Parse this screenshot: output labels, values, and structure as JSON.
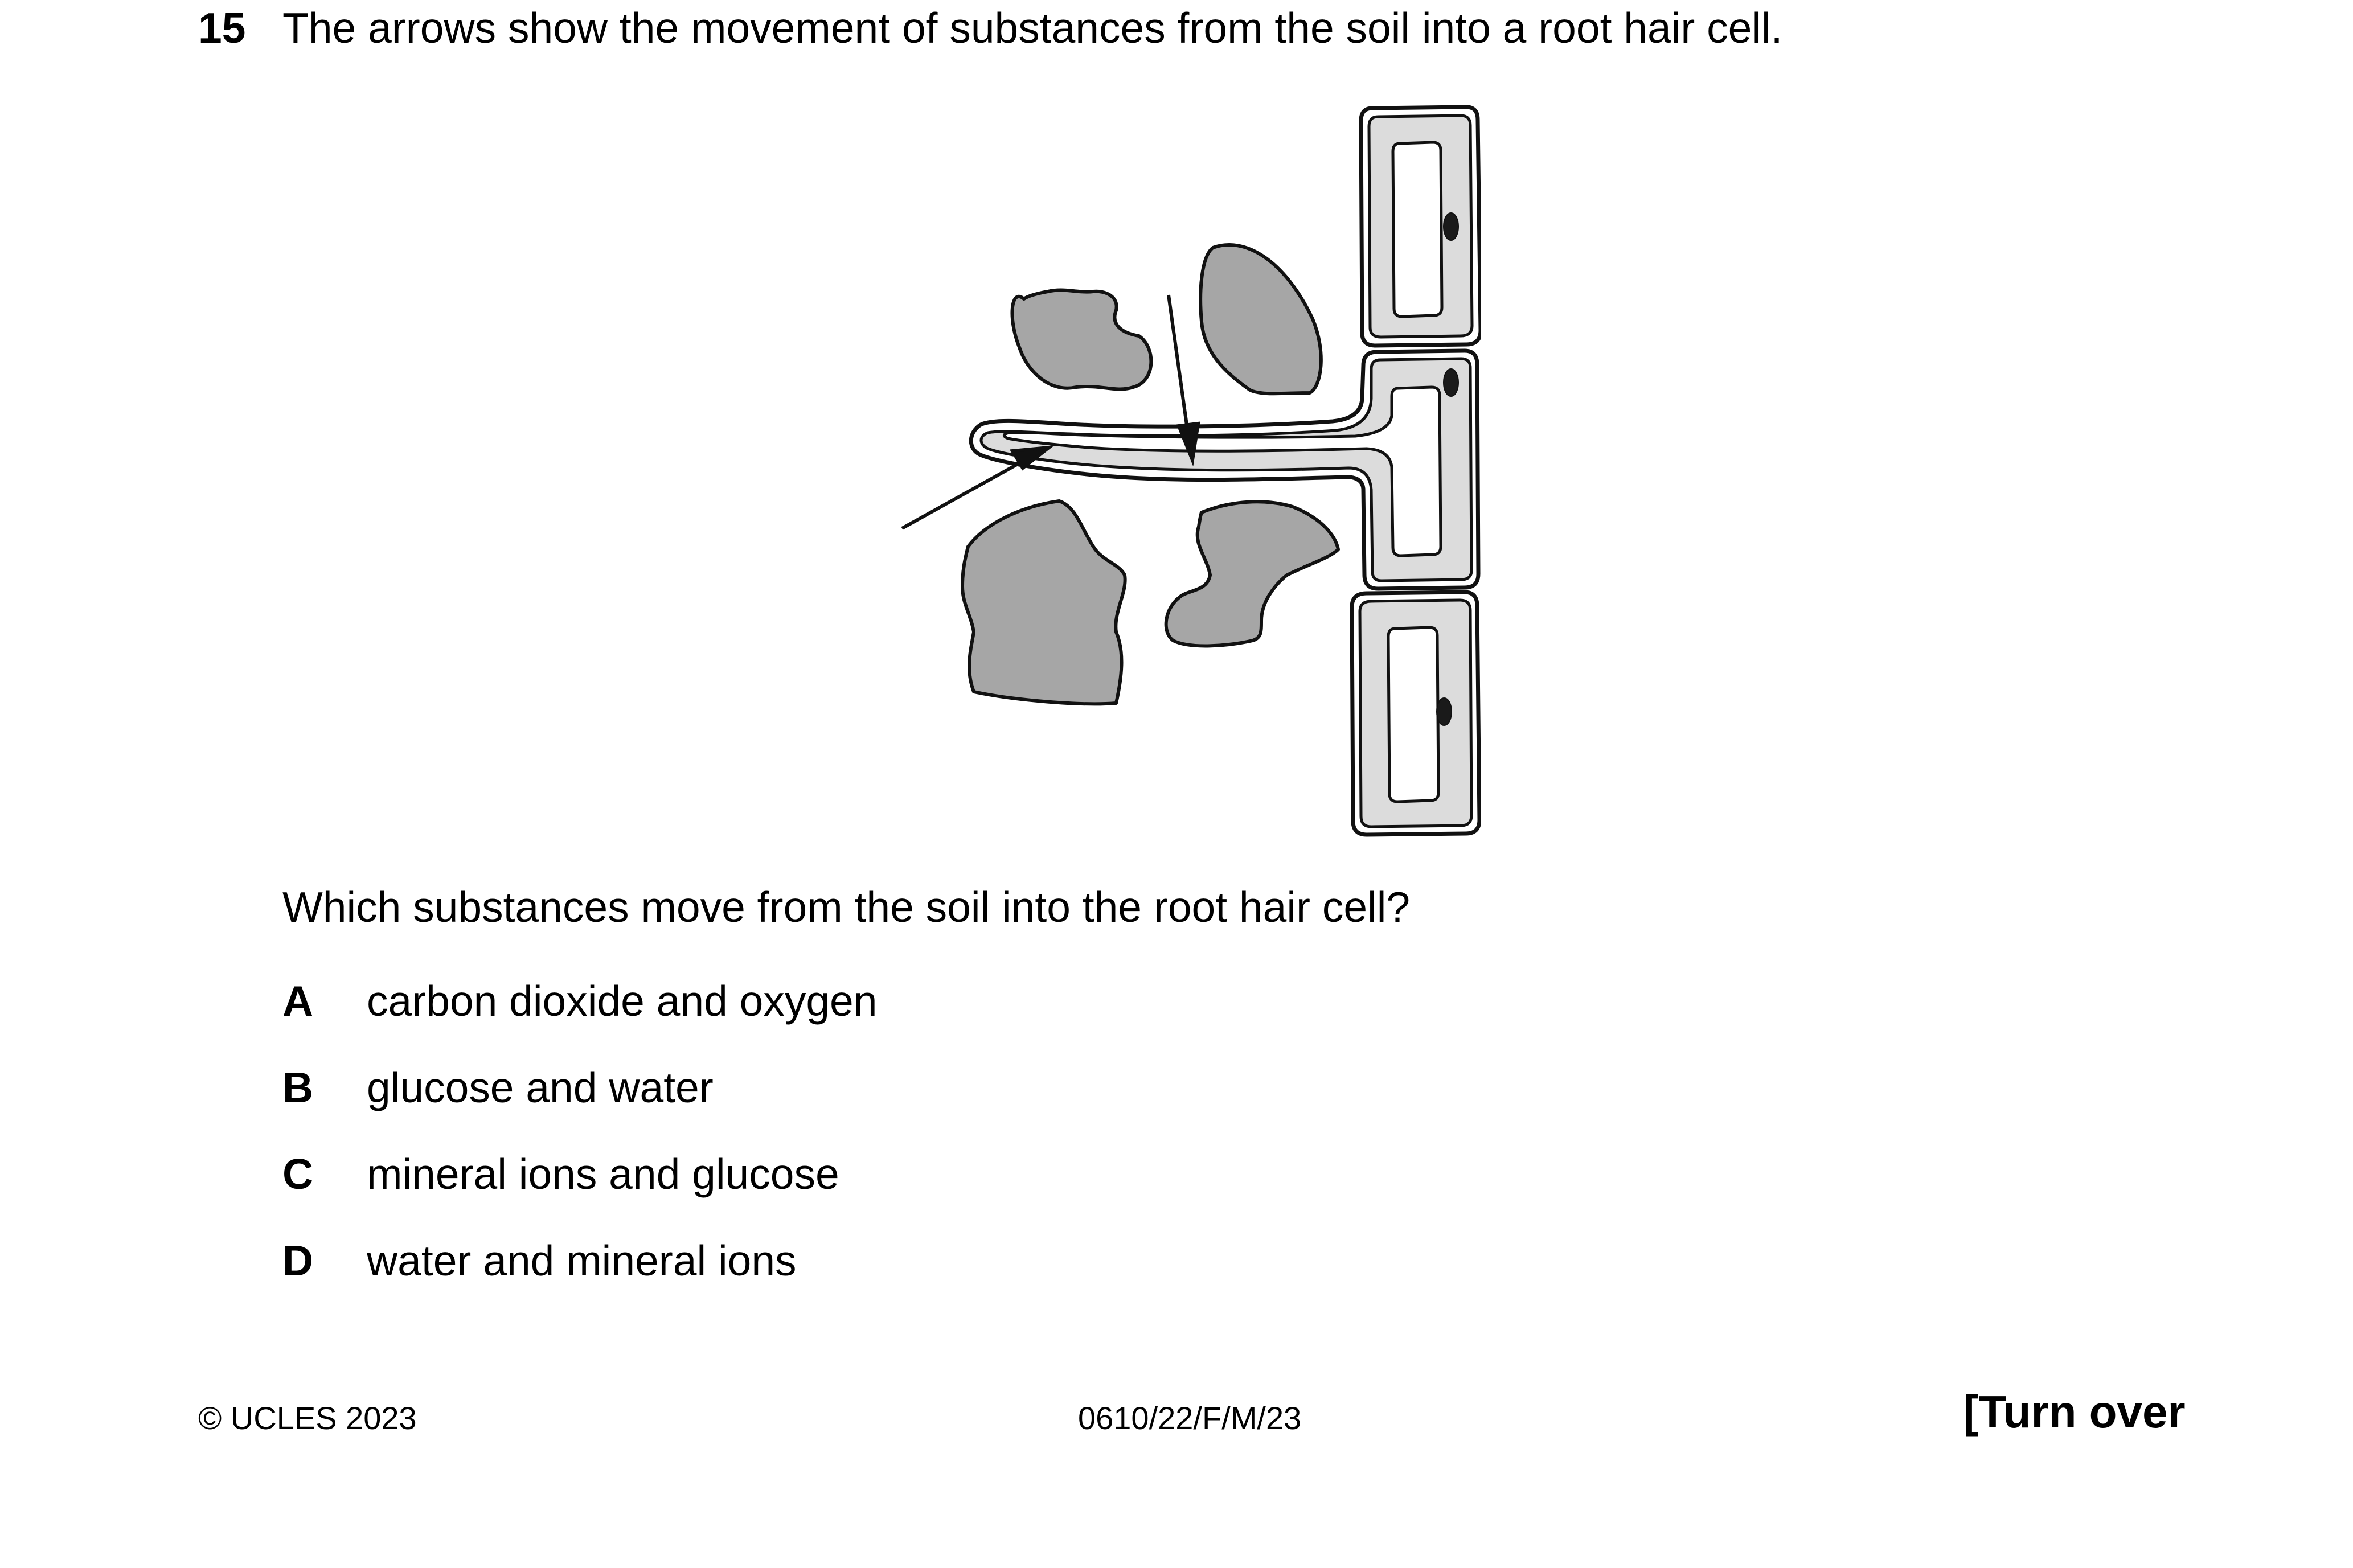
{
  "question": {
    "number": "15",
    "stem": "The arrows show the movement of substances from the soil into a root hair cell.",
    "prompt": "Which substances move from the soil into the root hair cell?",
    "options": [
      {
        "letter": "A",
        "text": "carbon dioxide and oxygen"
      },
      {
        "letter": "B",
        "text": "glucose and water"
      },
      {
        "letter": "C",
        "text": "mineral ions and glucose"
      },
      {
        "letter": "D",
        "text": "water and mineral ions"
      }
    ]
  },
  "footer": {
    "copyright": "© UCLES 2023",
    "code": "0610/22/F/M/23",
    "turn_over": "[Turn over"
  },
  "colors": {
    "soil_particle": "#a6a6a6",
    "cytoplasm": "#dcdcdc",
    "nucleus": "#1a1a1a",
    "outline": "#111111"
  }
}
